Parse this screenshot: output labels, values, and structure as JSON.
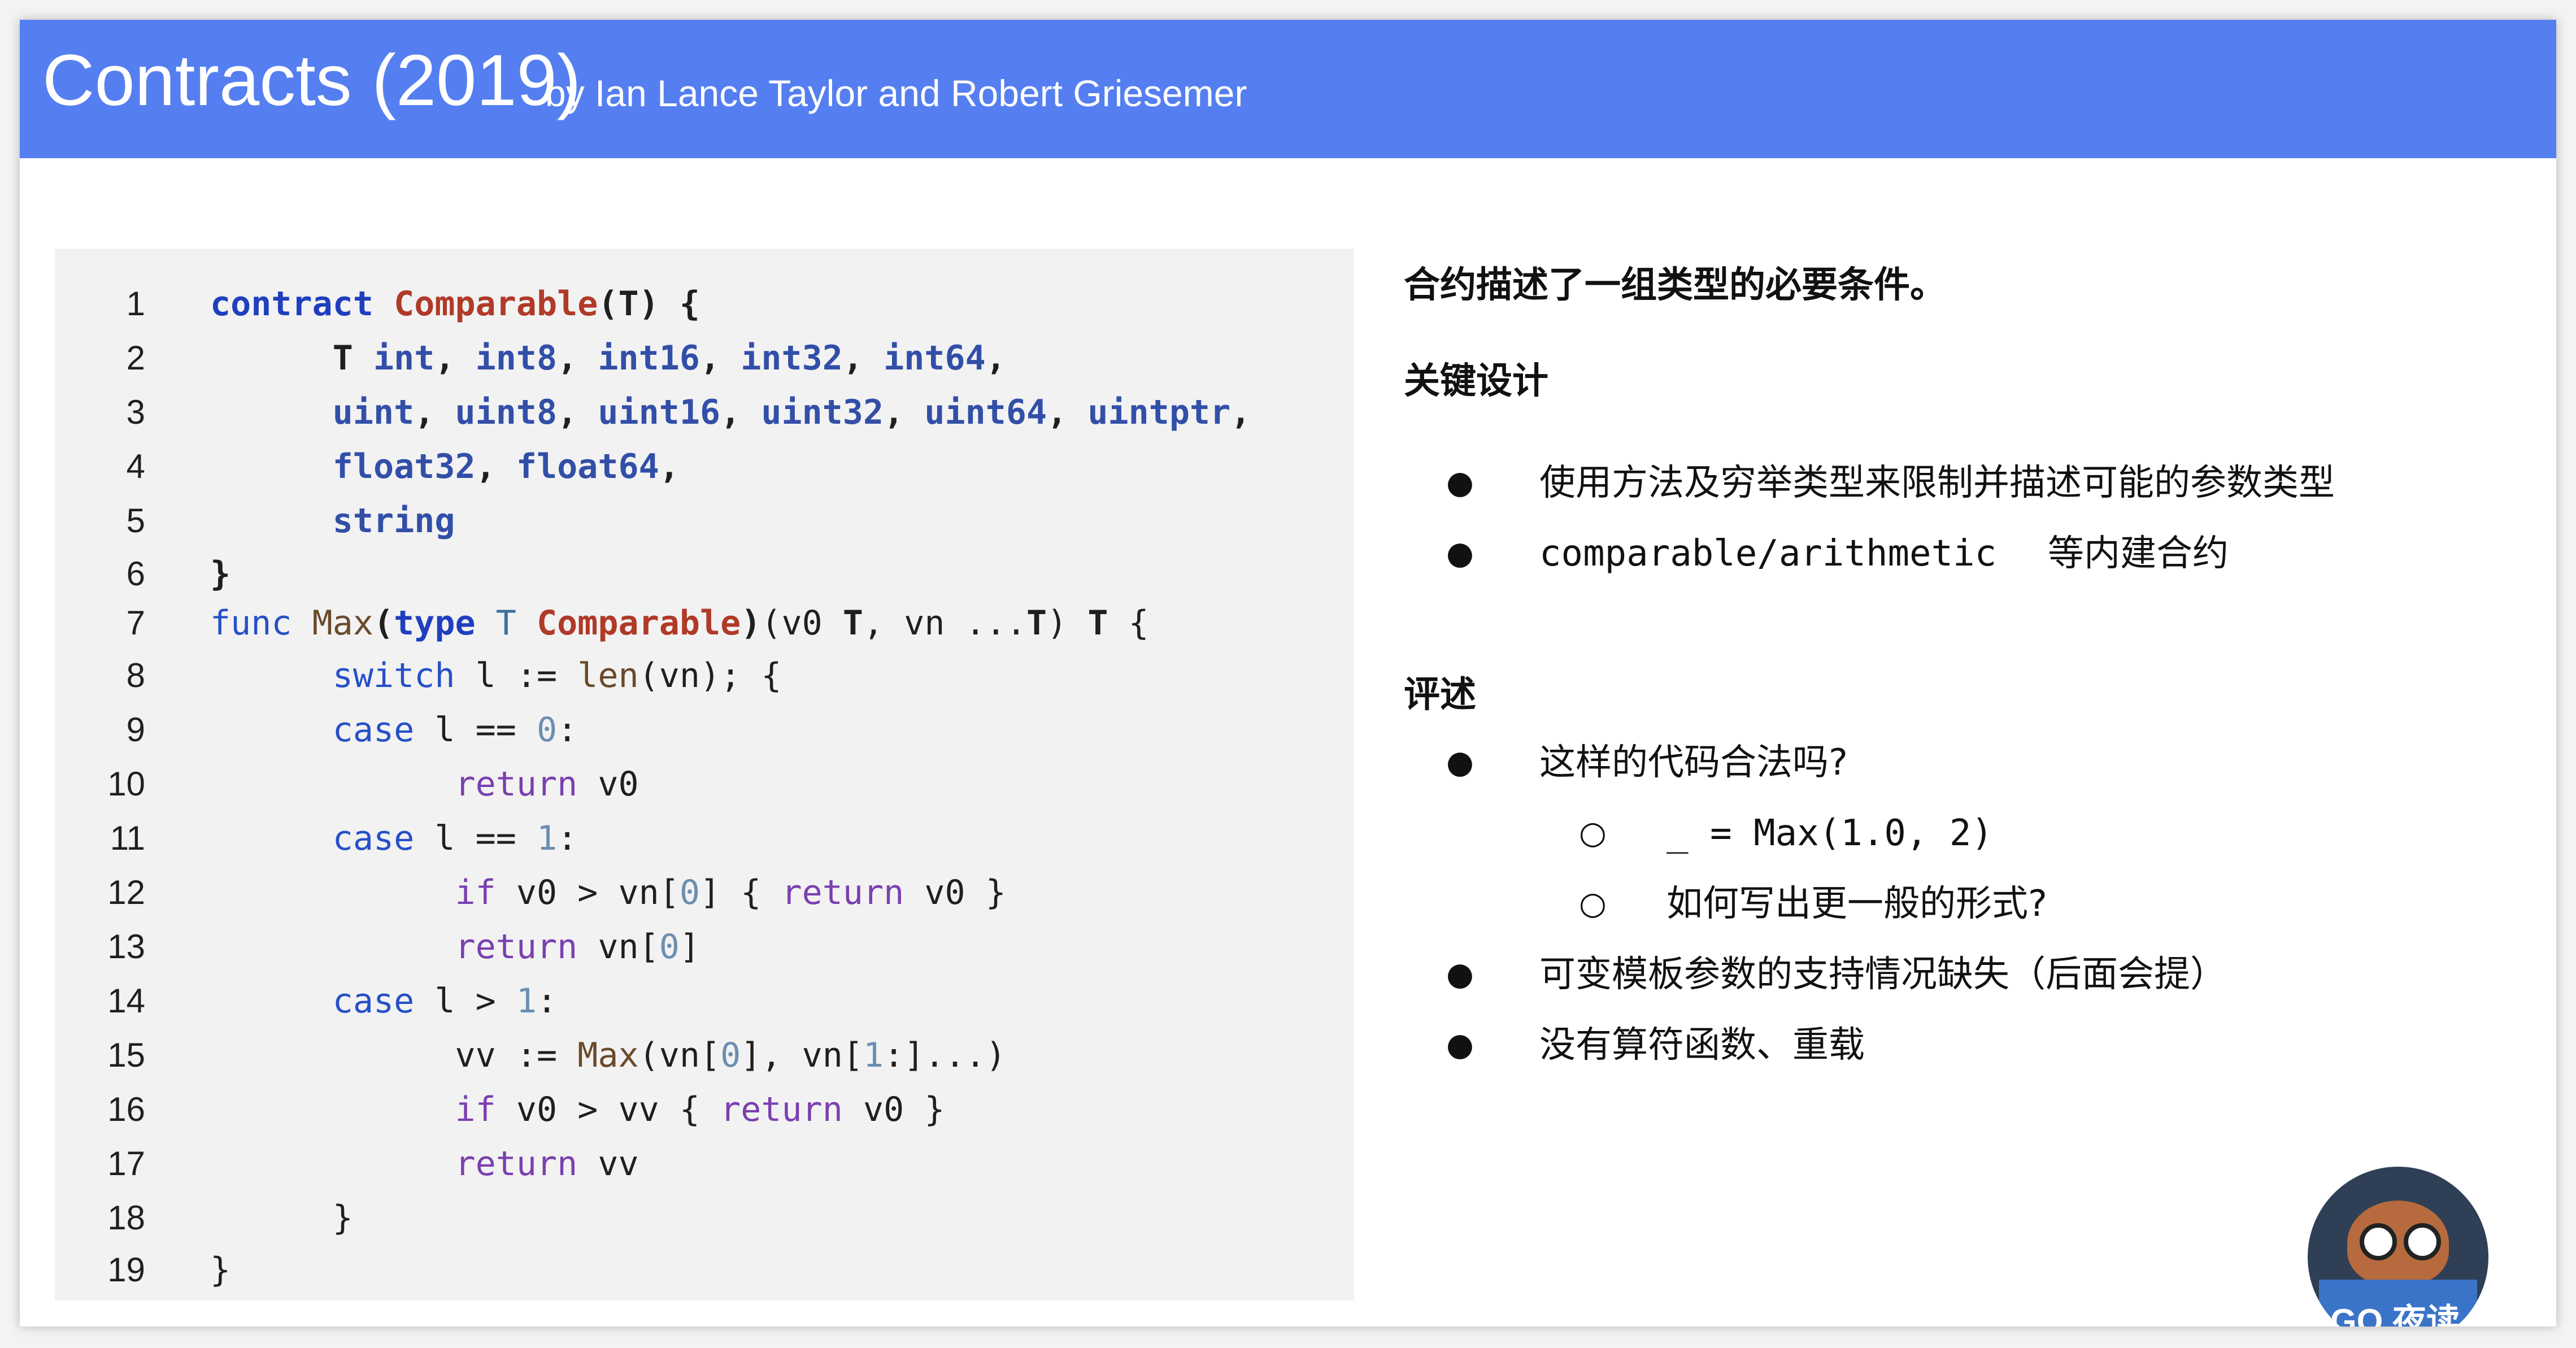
{
  "header": {
    "title": "Contracts (2019)",
    "subtitle": "by Ian Lance Taylor and Robert Griesemer"
  },
  "code": {
    "lines": [
      {
        "n": "1",
        "tokens": [
          [
            "kw",
            "contract "
          ],
          [
            "name",
            "Comparable"
          ],
          [
            "bold",
            "(T) {"
          ]
        ]
      },
      {
        "n": "2",
        "tokens": [
          [
            "plain",
            "      "
          ],
          [
            "bold",
            "T "
          ],
          [
            "type",
            "int"
          ],
          [
            "bold",
            ", "
          ],
          [
            "type",
            "int8"
          ],
          [
            "bold",
            ", "
          ],
          [
            "type",
            "int16"
          ],
          [
            "bold",
            ", "
          ],
          [
            "type",
            "int32"
          ],
          [
            "bold",
            ", "
          ],
          [
            "type",
            "int64"
          ],
          [
            "bold",
            ","
          ]
        ]
      },
      {
        "n": "3",
        "tokens": [
          [
            "plain",
            "      "
          ],
          [
            "type",
            "uint"
          ],
          [
            "bold",
            ", "
          ],
          [
            "type",
            "uint8"
          ],
          [
            "bold",
            ", "
          ],
          [
            "type",
            "uint16"
          ],
          [
            "bold",
            ", "
          ],
          [
            "type",
            "uint32"
          ],
          [
            "bold",
            ", "
          ],
          [
            "type",
            "uint64"
          ],
          [
            "bold",
            ", "
          ],
          [
            "type",
            "uintptr"
          ],
          [
            "bold",
            ","
          ]
        ]
      },
      {
        "n": "4",
        "tokens": [
          [
            "plain",
            "      "
          ],
          [
            "type",
            "float32"
          ],
          [
            "bold",
            ", "
          ],
          [
            "type",
            "float64"
          ],
          [
            "bold",
            ","
          ]
        ]
      },
      {
        "n": "5",
        "tokens": [
          [
            "plain",
            "      "
          ],
          [
            "type",
            "string"
          ]
        ]
      },
      {
        "n": "6",
        "tokens": [
          [
            "bold",
            "}"
          ]
        ]
      },
      {
        "n": "7",
        "tokens": [
          [
            "kw3",
            "func "
          ],
          [
            "fn",
            "Max"
          ],
          [
            "bold",
            "("
          ],
          [
            "kw",
            "type "
          ],
          [
            "typ2",
            "T "
          ],
          [
            "name",
            "Comparable"
          ],
          [
            "bold",
            ")"
          ],
          [
            "plain",
            "(v0 "
          ],
          [
            "bold",
            "T"
          ],
          [
            "plain",
            ", vn ..."
          ],
          [
            "bold",
            "T"
          ],
          [
            "plain",
            ") "
          ],
          [
            "bold",
            "T"
          ],
          [
            "plain",
            " {"
          ]
        ]
      },
      {
        "n": "8",
        "tokens": [
          [
            "plain",
            "      "
          ],
          [
            "kw3",
            "switch"
          ],
          [
            "plain",
            " l := "
          ],
          [
            "fn",
            "len"
          ],
          [
            "plain",
            "(vn); {"
          ]
        ]
      },
      {
        "n": "9",
        "tokens": [
          [
            "plain",
            "      "
          ],
          [
            "kw3",
            "case"
          ],
          [
            "plain",
            " l == "
          ],
          [
            "num",
            "0"
          ],
          [
            "plain",
            ":"
          ]
        ]
      },
      {
        "n": "10",
        "tokens": [
          [
            "plain",
            "            "
          ],
          [
            "kw2",
            "return"
          ],
          [
            "plain",
            " v0"
          ]
        ]
      },
      {
        "n": "11",
        "tokens": [
          [
            "plain",
            "      "
          ],
          [
            "kw3",
            "case"
          ],
          [
            "plain",
            " l == "
          ],
          [
            "num",
            "1"
          ],
          [
            "plain",
            ":"
          ]
        ]
      },
      {
        "n": "12",
        "tokens": [
          [
            "plain",
            "            "
          ],
          [
            "kw2",
            "if"
          ],
          [
            "plain",
            " v0 > vn["
          ],
          [
            "num",
            "0"
          ],
          [
            "plain",
            "] { "
          ],
          [
            "kw2",
            "return"
          ],
          [
            "plain",
            " v0 }"
          ]
        ]
      },
      {
        "n": "13",
        "tokens": [
          [
            "plain",
            "            "
          ],
          [
            "kw2",
            "return"
          ],
          [
            "plain",
            " vn["
          ],
          [
            "num",
            "0"
          ],
          [
            "plain",
            "]"
          ]
        ]
      },
      {
        "n": "14",
        "tokens": [
          [
            "plain",
            "      "
          ],
          [
            "kw3",
            "case"
          ],
          [
            "plain",
            " l > "
          ],
          [
            "num",
            "1"
          ],
          [
            "plain",
            ":"
          ]
        ]
      },
      {
        "n": "15",
        "tokens": [
          [
            "plain",
            "            vv := "
          ],
          [
            "fn",
            "Max"
          ],
          [
            "plain",
            "(vn["
          ],
          [
            "num",
            "0"
          ],
          [
            "plain",
            "], vn["
          ],
          [
            "num",
            "1"
          ],
          [
            "plain",
            ":]...)"
          ]
        ]
      },
      {
        "n": "16",
        "tokens": [
          [
            "plain",
            "            "
          ],
          [
            "kw2",
            "if"
          ],
          [
            "plain",
            " v0 > vv { "
          ],
          [
            "kw2",
            "return"
          ],
          [
            "plain",
            " v0 }"
          ]
        ]
      },
      {
        "n": "17",
        "tokens": [
          [
            "plain",
            "            "
          ],
          [
            "kw2",
            "return"
          ],
          [
            "plain",
            " vv"
          ]
        ]
      },
      {
        "n": "18",
        "tokens": [
          [
            "plain",
            "      }"
          ]
        ]
      },
      {
        "n": "19",
        "tokens": [
          [
            "plain",
            "}"
          ]
        ]
      }
    ]
  },
  "right": {
    "intro": "合约描述了一组类型的必要条件。",
    "design_heading": "关键设计",
    "design_items": [
      "使用方法及穷举类型来限制并描述可能的参数类型",
      "等内建合约"
    ],
    "design_item2_code": "comparable/arithmetic",
    "review_heading": "评述",
    "review_q1": "这样的代码合法吗?",
    "review_q1_sub1": "_ = Max(1.0, 2)",
    "review_q1_sub2": "如何写出更一般的形式?",
    "review_items": [
      "可变模板参数的支持情况缺失（后面会提）",
      "没有算符函数、重载"
    ],
    "bullet": "●",
    "sub_bullet": "○"
  },
  "mascot": {
    "text": "GO 夜读"
  },
  "colors": {
    "header_bg": "#557ff0",
    "code_bg": "#f2f2f2"
  }
}
